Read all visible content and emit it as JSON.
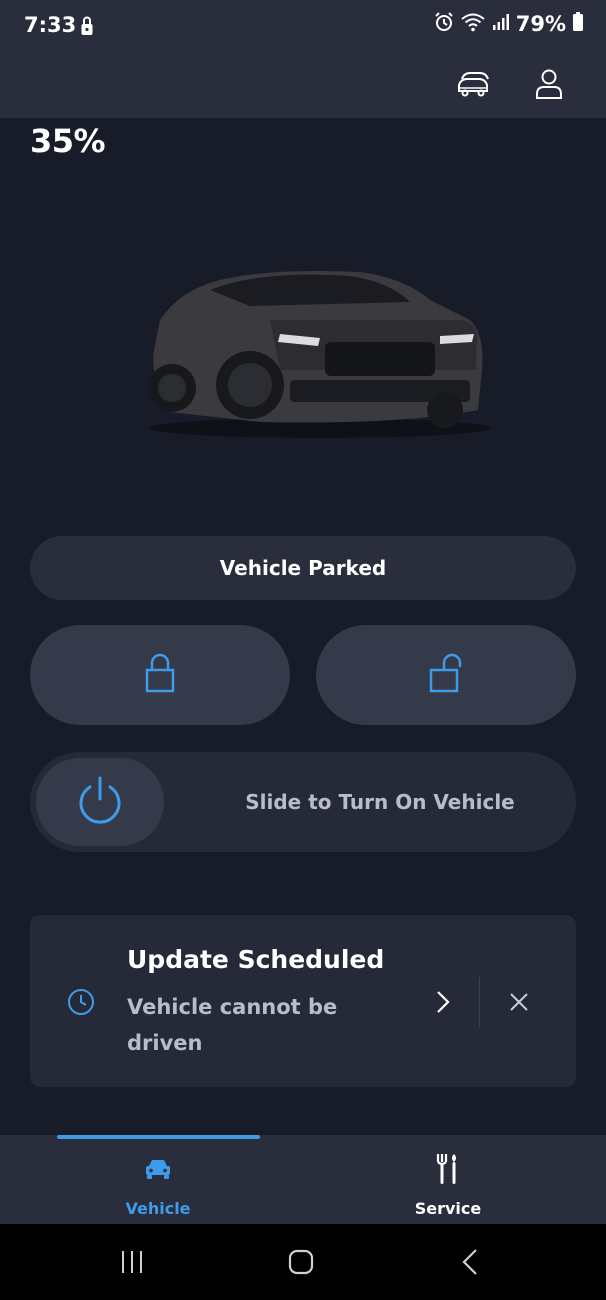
{
  "status_bar": {
    "time": "7:33",
    "battery": "79%",
    "icons": [
      "lock-icon",
      "alarm-icon",
      "wifi-icon",
      "signal-icon",
      "battery-icon"
    ]
  },
  "header": {
    "icons": [
      "garage-cars-icon",
      "profile-icon"
    ]
  },
  "vehicle": {
    "charge_level": "35%",
    "status": "Vehicle Parked",
    "image": "mustang-car-image"
  },
  "controls": {
    "lock_icon": "lock-icon",
    "unlock_icon": "unlock-icon",
    "slide_label": "Slide to Turn On Vehicle",
    "power_icon": "power-icon"
  },
  "update_card": {
    "title": "Update Scheduled",
    "subtitle": "Vehicle cannot be driven",
    "icons": [
      "clock-icon",
      "chevron-right-icon",
      "close-icon"
    ]
  },
  "tabs": [
    {
      "label": "Vehicle",
      "icon": "car-icon",
      "active": true
    },
    {
      "label": "Service",
      "icon": "tools-icon",
      "active": false
    }
  ],
  "nav": [
    "recents-button",
    "home-button",
    "back-button"
  ],
  "colors": {
    "accent": "#3d9be9",
    "background": "#181c29",
    "surface": "#2a2e3c",
    "button": "#353a4b"
  }
}
